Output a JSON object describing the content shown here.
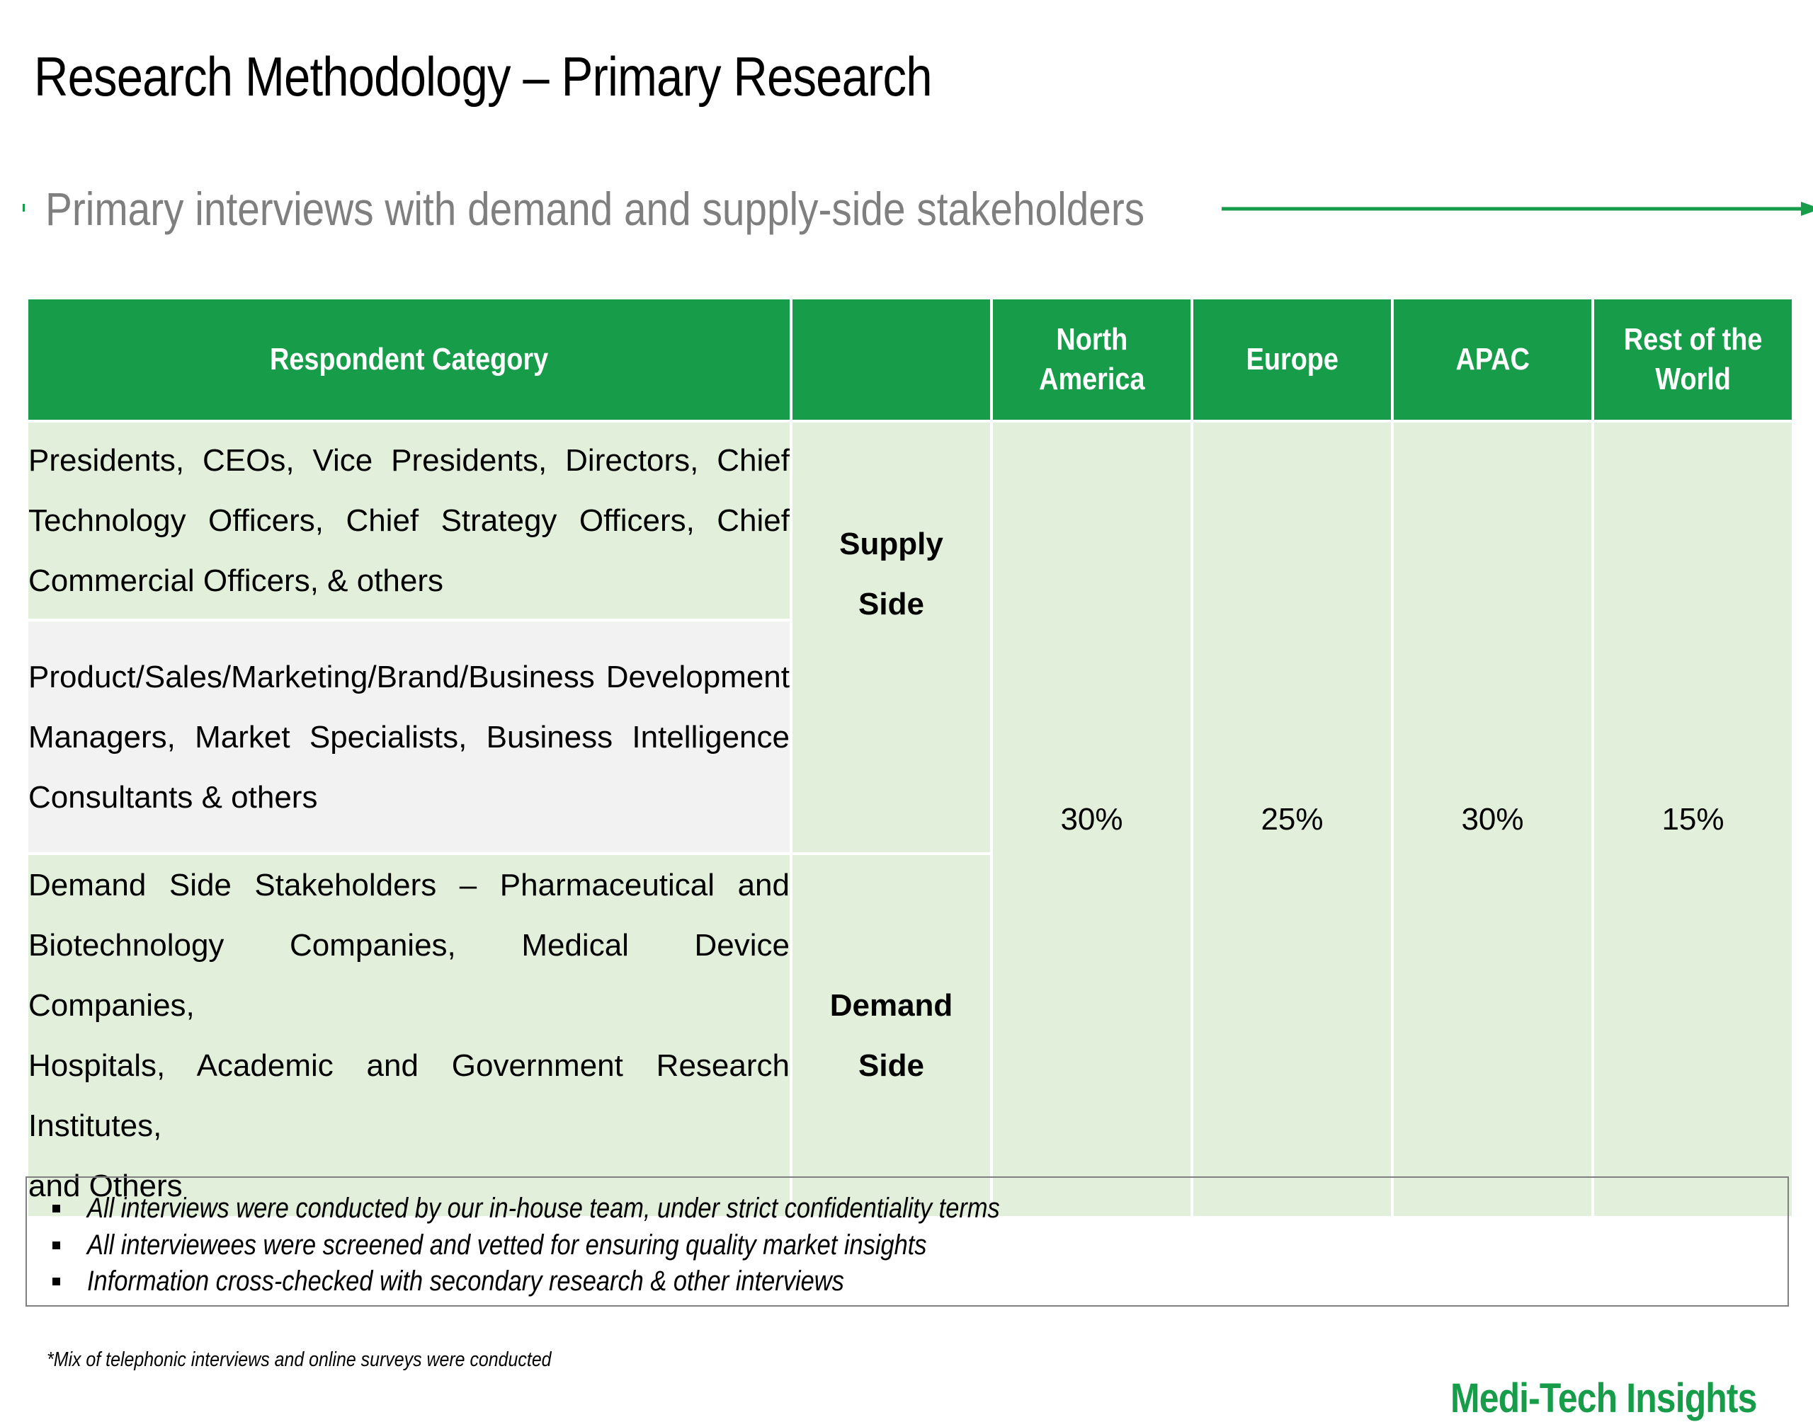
{
  "page": {
    "title": "Research Methodology – Primary Research",
    "subtitle": "Primary interviews with demand and supply-side stakeholders"
  },
  "table": {
    "headers": [
      "Respondent Category",
      "",
      "North America",
      "Europe",
      "APAC",
      "Rest of the World"
    ],
    "header_lines": {
      "north_america": [
        "North",
        "America"
      ],
      "rest_of_world": [
        "Rest of the",
        "World"
      ]
    },
    "rows": [
      {
        "lines": [
          "Presidents, CEOs, Vice Presidents, Directors, Chief",
          "Technology Officers, Chief Strategy Officers, Chief",
          "Commercial Officers, & others"
        ]
      },
      {
        "lines": [
          "Product/Sales/Marketing/Brand/Business Development",
          "Managers, Market Specialists, Business Intelligence",
          "Consultants & others"
        ]
      },
      {
        "lines": [
          "Demand Side Stakeholders – Pharmaceutical and",
          "Biotechnology Companies, Medical Device Companies,",
          "Hospitals, Academic and Government Research Institutes,",
          "and Others"
        ]
      }
    ],
    "sides": {
      "supply": [
        "Supply",
        "Side"
      ],
      "demand": [
        "Demand",
        "Side"
      ]
    },
    "shares": {
      "north_america": "30%",
      "europe": "25%",
      "apac": "30%",
      "rest_of_world": "15%"
    }
  },
  "notes": [
    "All interviews were conducted by our in-house team, under strict confidentiality terms",
    "All interviewees were screened and vetted for ensuring quality market insights",
    "Information cross-checked with secondary research & other interviews"
  ],
  "footnote": "*Mix of telephonic interviews and online surveys were conducted",
  "brand": "Medi-Tech Insights",
  "colors": {
    "accent_green": "#179c4a",
    "light_green": "#e2efda",
    "light_grey": "#f2f2f2",
    "subtitle_grey": "#7f7f7f"
  }
}
